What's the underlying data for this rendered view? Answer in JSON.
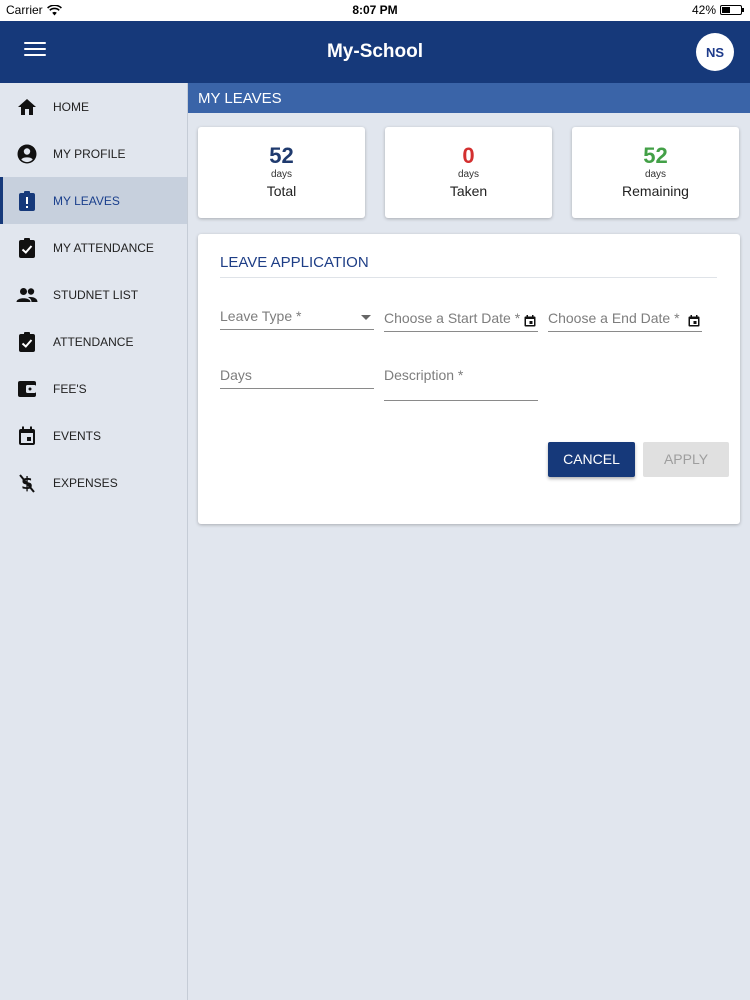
{
  "status_bar": {
    "carrier": "Carrier",
    "time": "8:07 PM",
    "battery_percent": "42%",
    "battery_level": 0.42
  },
  "app_bar": {
    "title": "My-School",
    "avatar_initials": "NS",
    "menu_icon": "hamburger-menu-icon"
  },
  "sidebar": {
    "items": [
      {
        "label": "HOME",
        "icon": "home-icon",
        "active": false
      },
      {
        "label": "MY PROFILE",
        "icon": "account-circle-icon",
        "active": false
      },
      {
        "label": "MY LEAVES",
        "icon": "clipboard-alert-icon",
        "active": true
      },
      {
        "label": "MY ATTENDANCE",
        "icon": "clipboard-check-icon",
        "active": false
      },
      {
        "label": "STUDNET LIST",
        "icon": "people-icon",
        "active": false
      },
      {
        "label": "ATTENDANCE",
        "icon": "clipboard-check-icon",
        "active": false
      },
      {
        "label": "FEE'S",
        "icon": "wallet-icon",
        "active": false
      },
      {
        "label": "EVENTS",
        "icon": "calendar-event-icon",
        "active": false
      },
      {
        "label": "EXPENSES",
        "icon": "money-off-icon",
        "active": false
      }
    ]
  },
  "main": {
    "section_title": "MY LEAVES",
    "stats": [
      {
        "value": "52",
        "unit": "days",
        "label": "Total",
        "color": "#1f3a6e"
      },
      {
        "value": "0",
        "unit": "days",
        "label": "Taken",
        "color": "#d32f2f"
      },
      {
        "value": "52",
        "unit": "days",
        "label": "Remaining",
        "color": "#43a047"
      }
    ],
    "form": {
      "title": "LEAVE APPLICATION",
      "leave_type_label": "Leave Type *",
      "start_date_label": "Choose a Start Date *",
      "end_date_label": "Choose a End Date *",
      "days_label": "Days",
      "description_label": "Description *",
      "cancel_label": "CANCEL",
      "apply_label": "APPLY"
    }
  },
  "colors": {
    "primary": "#16397a",
    "section_header": "#3a64a8",
    "background": "#e1e6ee"
  }
}
